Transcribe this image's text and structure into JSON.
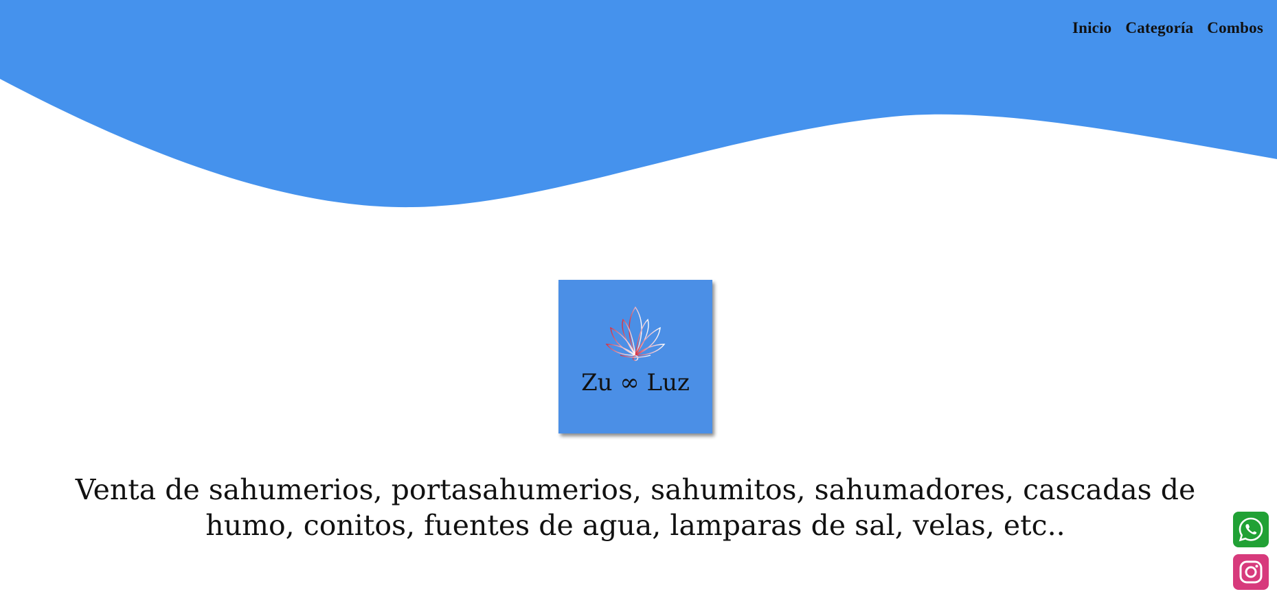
{
  "nav": {
    "items": [
      {
        "label": "Inicio"
      },
      {
        "label": "Categoría"
      },
      {
        "label": "Combos"
      }
    ]
  },
  "logo": {
    "name": "Zu ∞ Luz",
    "icon": "lotus-icon"
  },
  "tagline": "Venta de sahumerios, portasahumerios, sahumitos, sahumadores, cascadas de humo, conitos, fuentes de agua, lamparas de sal, velas, etc..",
  "social": [
    {
      "name": "whatsapp",
      "icon": "whatsapp-icon",
      "color": "#21a135"
    },
    {
      "name": "instagram",
      "icon": "instagram-icon",
      "color": "#d73a7c"
    }
  ],
  "colors": {
    "header_blue": "#4592ed",
    "logo_bg": "#4b8fe6"
  }
}
